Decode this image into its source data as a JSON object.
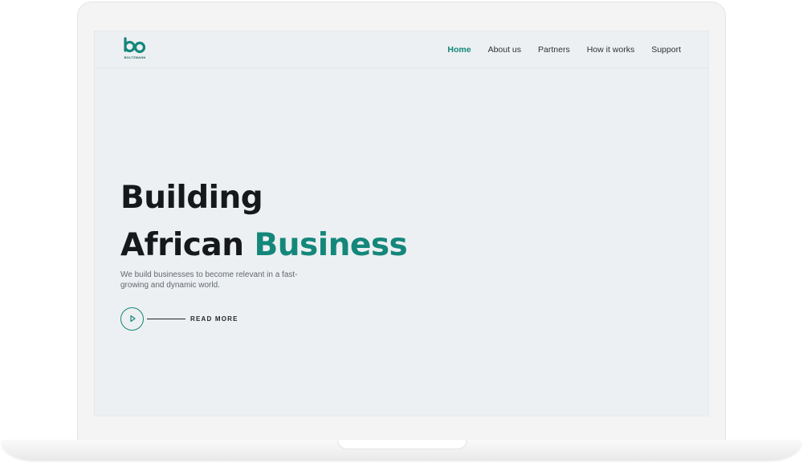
{
  "logo": {
    "text": "BOLTZMANN",
    "icon": "bo-logo-icon",
    "color": "#14877b"
  },
  "nav": {
    "items": [
      {
        "label": "Home",
        "active": true
      },
      {
        "label": "About us",
        "active": false
      },
      {
        "label": "Partners",
        "active": false
      },
      {
        "label": "How it works",
        "active": false
      },
      {
        "label": "Support",
        "active": false
      }
    ]
  },
  "hero": {
    "title_line1": "Building",
    "title_line2_plain": "African",
    "title_line2_accent": "Business",
    "subtitle": "We build businesses to become relevant  in a fast-growing and dynamic world.",
    "cta_label": "READ MORE",
    "cta_icon": "play-icon"
  },
  "colors": {
    "accent": "#14877b",
    "screen_bg": "#edf0f2",
    "text_dark": "#16181b"
  }
}
